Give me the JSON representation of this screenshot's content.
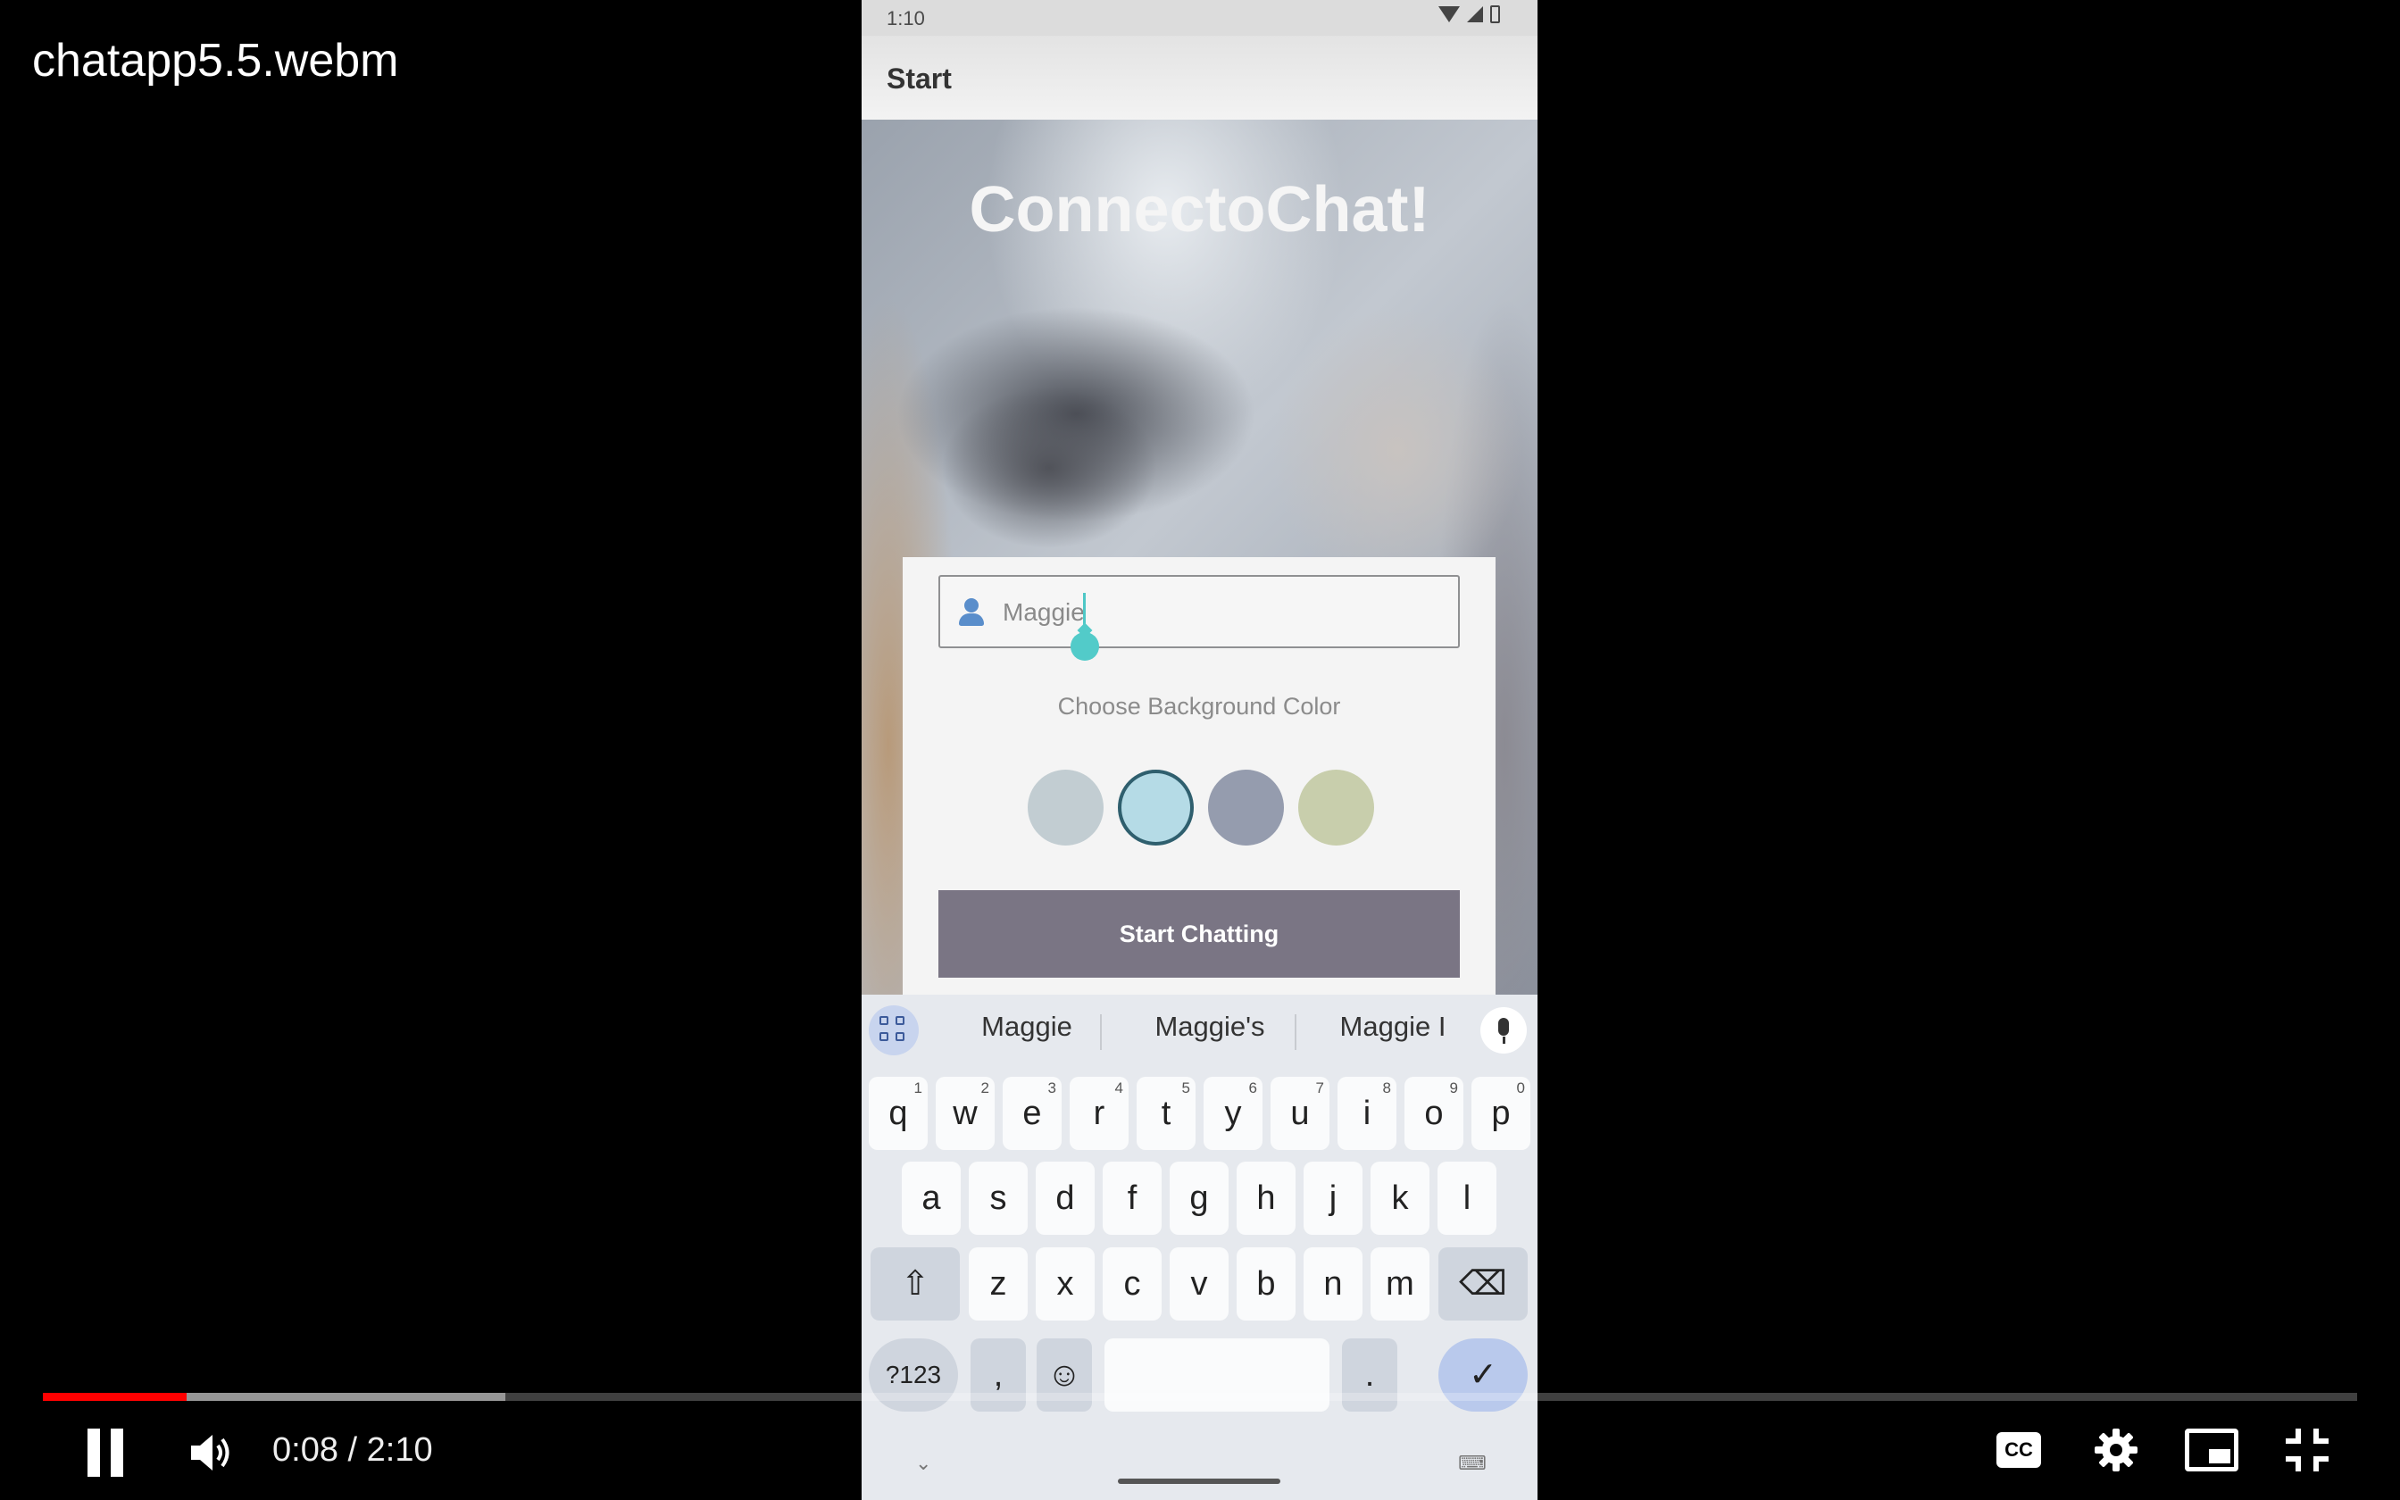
{
  "player": {
    "video_title": "chatapp5.5.webm",
    "current_time": "0:08",
    "duration": "2:10",
    "timecode": "0:08 / 2:10",
    "progress_fraction": 0.062,
    "buffered_fraction": 0.2,
    "progress_color": "#ff0000",
    "controls": [
      "pause-icon",
      "volume-icon",
      "closed-captions-icon",
      "settings-gear-icon",
      "miniplayer-icon",
      "exit-fullscreen-icon"
    ],
    "cc_label": "CC"
  },
  "phone": {
    "status": {
      "time": "1:10"
    },
    "app_bar": {
      "title": "Start"
    },
    "app_title": "ConnectoChat!",
    "form": {
      "name_value": "Maggie",
      "color_label": "Choose Background Color",
      "swatches": [
        {
          "color": "#c2cdd2",
          "selected": false
        },
        {
          "color": "#b5dbe6",
          "selected": true
        },
        {
          "color": "#959cae",
          "selected": false
        },
        {
          "color": "#c8ceac",
          "selected": false
        }
      ],
      "start_label": "Start Chatting",
      "button_color": "#7a7584"
    },
    "keyboard": {
      "suggestions": [
        "Maggie",
        "Maggie's",
        "Maggie I"
      ],
      "row1": [
        {
          "k": "q",
          "h": "1"
        },
        {
          "k": "w",
          "h": "2"
        },
        {
          "k": "e",
          "h": "3"
        },
        {
          "k": "r",
          "h": "4"
        },
        {
          "k": "t",
          "h": "5"
        },
        {
          "k": "y",
          "h": "6"
        },
        {
          "k": "u",
          "h": "7"
        },
        {
          "k": "i",
          "h": "8"
        },
        {
          "k": "o",
          "h": "9"
        },
        {
          "k": "p",
          "h": "0"
        }
      ],
      "row2": [
        "a",
        "s",
        "d",
        "f",
        "g",
        "h",
        "j",
        "k",
        "l"
      ],
      "row3": [
        "z",
        "x",
        "c",
        "v",
        "b",
        "n",
        "m"
      ],
      "symbols_label": "?123",
      "comma": ",",
      "period": ".",
      "shift_glyph": "⇧",
      "backspace_glyph": "⌫",
      "emoji_glyph": "☺",
      "done_glyph": "✓",
      "nav_down_glyph": "⌄",
      "nav_keyboard_glyph": "⌨"
    }
  }
}
